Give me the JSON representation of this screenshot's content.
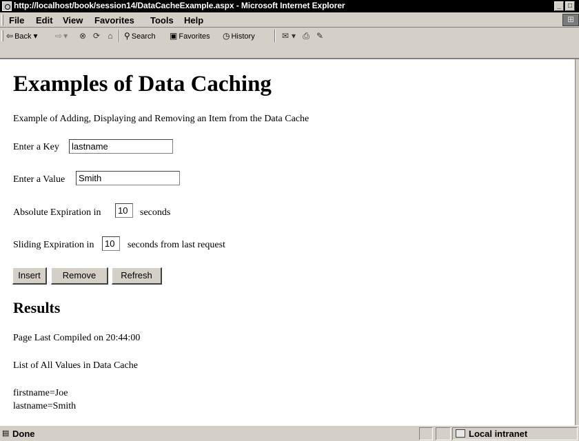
{
  "window": {
    "title": "http://localhost/book/session14/DataCacheExample.aspx - Microsoft Internet Explorer",
    "minimize_glyph": "_",
    "maximize_glyph": "□"
  },
  "menu": {
    "items": [
      "File",
      "Edit",
      "View",
      "Favorites",
      "Tools",
      "Help"
    ]
  },
  "toolbar": {
    "back_label": "Back",
    "search_label": "Search",
    "favorites_label": "Favorites",
    "history_label": "History",
    "icons": [
      "back-arrow-icon",
      "forward-arrow-icon",
      "stop-icon",
      "refresh-icon",
      "home-icon",
      "search-icon",
      "favorites-icon",
      "history-icon",
      "mail-icon",
      "print-icon",
      "edit-icon"
    ]
  },
  "page": {
    "title": "Examples of Data Caching",
    "intro": "Example of Adding, Displaying and Removing an Item from the Data Cache",
    "key_label": "Enter a Key",
    "key_value": "lastname",
    "value_label": "Enter a Value",
    "value_value": "Smith",
    "absolute_label": "Absolute Expiration in",
    "absolute_value": "10",
    "absolute_suffix": "seconds",
    "sliding_label": "Sliding Expiration in",
    "sliding_value": "10",
    "sliding_suffix": "seconds from last request",
    "insert_label": "Insert",
    "remove_label": "Remove",
    "refresh_label": "Refresh",
    "results_heading": "Results",
    "compiled_text": "Page Last Compiled on 20:44:00",
    "list_heading": "List of All Values in Data Cache",
    "cache_entries": [
      "firstname=Joe",
      "lastname=Smith"
    ]
  },
  "status": {
    "text": "Done",
    "zone": "Local intranet"
  },
  "colors": {
    "chrome": "#d4d0c8",
    "titlebar": "#000000"
  }
}
